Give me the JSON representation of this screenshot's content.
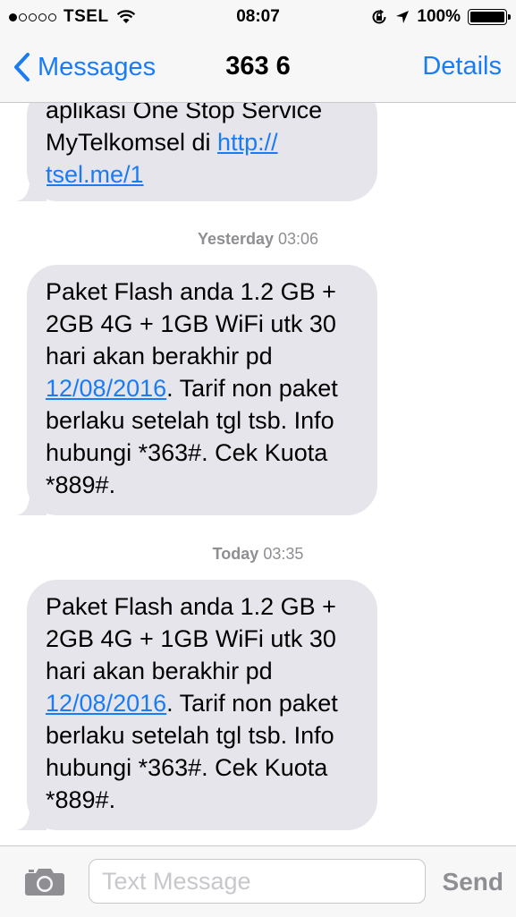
{
  "status_bar": {
    "carrier": "TSEL",
    "time": "08:07",
    "battery": "100%",
    "signal_bars_filled": 1,
    "signal_bars_total": 5
  },
  "nav": {
    "back_label": "Messages",
    "title": "363 6",
    "details_label": "Details"
  },
  "thread": {
    "messages": [
      {
        "text_before_link": "aplikasi One Stop Service MyTelkomsel di ",
        "link": "http://tsel.me/1",
        "link_line1": "http://",
        "link_line2": "tsel.me/1",
        "text_after_link": ""
      },
      {
        "stamp_day": "Yesterday",
        "stamp_time": "03:06",
        "text_before_link": "Paket Flash anda 1.2 GB + 2GB 4G + 1GB WiFi utk 30 hari akan berakhir pd ",
        "link": "12/08/2016",
        "text_after_link": ". Tarif non paket berlaku setelah tgl tsb. Info hubungi *363#. Cek Kuota *889#."
      },
      {
        "stamp_day": "Today",
        "stamp_time": "03:35",
        "text_before_link": "Paket Flash anda 1.2 GB + 2GB 4G + 1GB WiFi utk 30 hari akan berakhir pd ",
        "link": "12/08/2016",
        "text_after_link": ". Tarif non paket berlaku setelah tgl tsb. Info hubungi *363#. Cek Kuota *889#."
      }
    ]
  },
  "input_bar": {
    "placeholder": "Text Message",
    "send_label": "Send",
    "camera_icon": "camera-icon"
  },
  "colors": {
    "accent": "#1a7cf5",
    "bubble": "#e6e5eb",
    "bar": "#f7f7f7",
    "muted": "#8e8e93"
  }
}
